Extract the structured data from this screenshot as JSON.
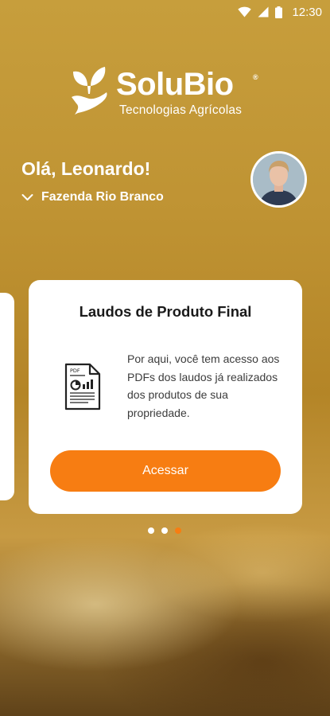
{
  "status_bar": {
    "time": "12:30",
    "icons": [
      "wifi-icon",
      "cellular-signal-icon",
      "battery-icon"
    ]
  },
  "brand": {
    "name": "SoluBio",
    "registered": "®",
    "tagline": "Tecnologias Agrícolas"
  },
  "user": {
    "greeting": "Olá, Leonardo!",
    "farm": "Fazenda Rio Branco"
  },
  "card": {
    "title": "Laudos de Produto Final",
    "description": "Por aqui, você tem acesso aos PDFs dos laudos já realizados dos produtos de sua propriedade.",
    "icon": "pdf-document-icon",
    "button_label": "Acessar"
  },
  "carousel": {
    "pages": 3,
    "active_index": 2
  },
  "colors": {
    "accent": "#f77d12",
    "card_background": "#ffffff"
  }
}
